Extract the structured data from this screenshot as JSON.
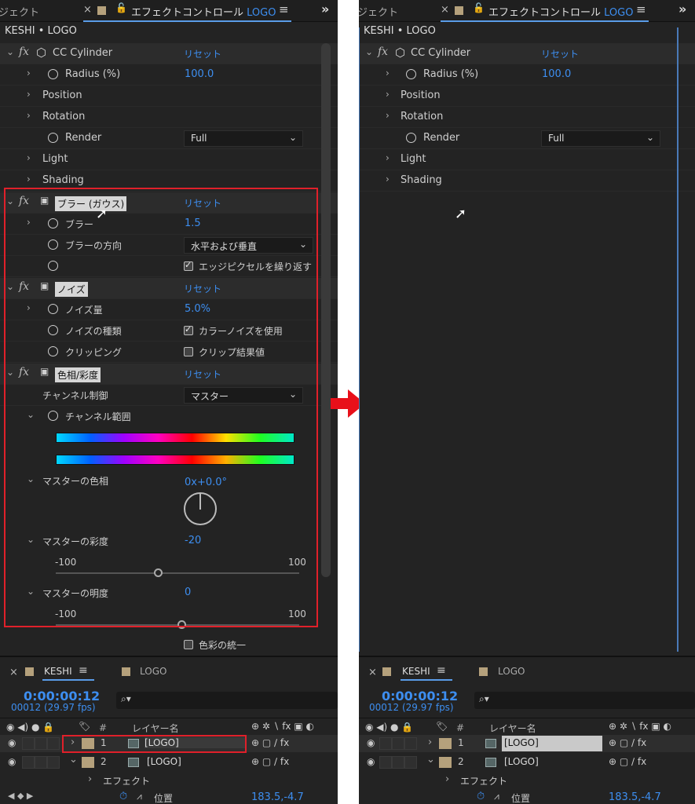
{
  "left": {
    "tab_prev": "ジェクト",
    "tab_title": "エフェクトコントロール",
    "tab_layer": "LOGO",
    "breadcrumb": "KESHI • LOGO",
    "cc": {
      "name": "CC Cylinder",
      "reset": "リセット",
      "radius_label": "Radius (%)",
      "radius_value": "100.0",
      "position": "Position",
      "rotation": "Rotation",
      "render_label": "Render",
      "render_value": "Full",
      "light": "Light",
      "shading": "Shading"
    },
    "blur": {
      "name": "ブラー (ガウス)",
      "reset": "リセット",
      "amount_label": "ブラー",
      "amount_value": "1.5",
      "dir_label": "ブラーの方向",
      "dir_value": "水平および垂直",
      "repeat_label": "エッジピクセルを繰り返す"
    },
    "noise": {
      "name": "ノイズ",
      "reset": "リセット",
      "amount_label": "ノイズ量",
      "amount_value": "5.0%",
      "type_label": "ノイズの種類",
      "type_value": "カラーノイズを使用",
      "clip_label": "クリッピング",
      "clip_value": "クリップ結果値"
    },
    "hue": {
      "name": "色相/彩度",
      "reset": "リセット",
      "channel_label": "チャンネル制御",
      "channel_value": "マスター",
      "range_label": "チャンネル範囲",
      "master_hue_label": "マスターの色相",
      "master_hue_value": "0x+0.0°",
      "master_sat_label": "マスターの彩度",
      "master_sat_value": "-20",
      "sat_min": "-100",
      "sat_max": "100",
      "master_light_label": "マスターの明度",
      "master_light_value": "0",
      "light_min": "-100",
      "light_max": "100",
      "colorize_label": "色彩の統一"
    }
  },
  "right": {
    "tab_prev": "ジェクト",
    "tab_title": "エフェクトコントロール",
    "tab_layer": "LOGO",
    "breadcrumb": "KESHI • LOGO",
    "cc": {
      "name": "CC Cylinder",
      "reset": "リセット",
      "radius_label": "Radius (%)",
      "radius_value": "100.0",
      "position": "Position",
      "rotation": "Rotation",
      "render_label": "Render",
      "render_value": "Full",
      "light": "Light",
      "shading": "Shading"
    }
  },
  "timeline": {
    "comp_tab": "KESHI",
    "logo_tab": "LOGO",
    "timecode": "0:00:00:12",
    "frames": "00012 (29.97 fps)",
    "col_hash": "#",
    "col_layer": "レイヤー名",
    "layers": [
      {
        "num": "1",
        "name": "[LOGO]"
      },
      {
        "num": "2",
        "name": "[LOGO]"
      }
    ],
    "effects_label": "エフェクト",
    "position_label": "位置",
    "position_value": "183.5,-4.7"
  },
  "colors": {
    "accent": "#3d8ef0",
    "highlight_box": "#e0202a",
    "arrow": "#e8101a"
  },
  "icons": [
    "stopwatch-icon",
    "lock-icon",
    "fx-icon",
    "cube-icon",
    "eye-icon",
    "camera-icon",
    "search-icon"
  ]
}
